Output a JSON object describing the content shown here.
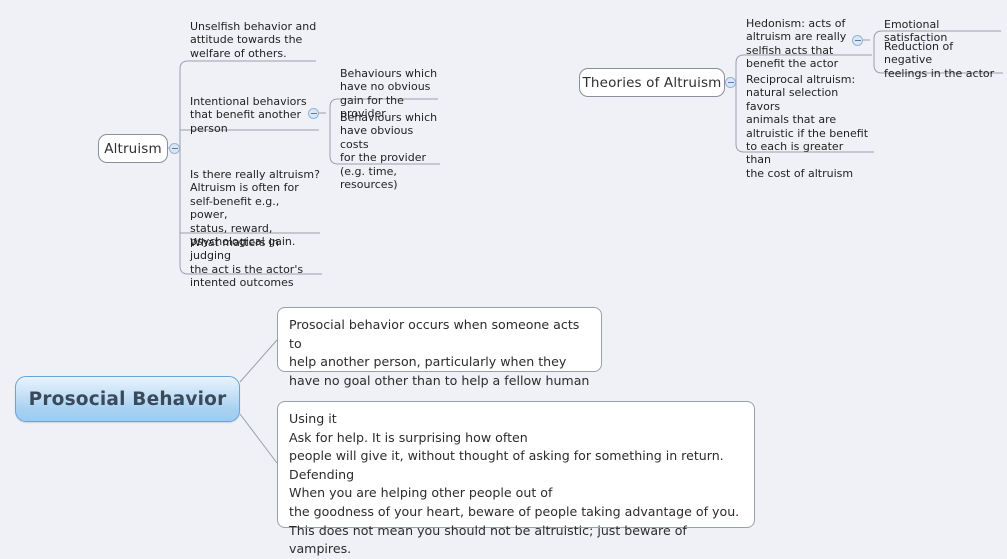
{
  "app": {
    "type": "mind-map",
    "canvas_background": "#f0f1f6",
    "accent_color": "#9ecbef",
    "node_border_color": "#8a8f98",
    "connector_color": "#9aa0a8"
  },
  "map": {
    "root_nodes": [
      {
        "id": "altruism",
        "label": "Altruism"
      },
      {
        "id": "theories",
        "label": "Theories of Altruism"
      },
      {
        "id": "prosocial",
        "label": "Prosocial Behavior"
      }
    ]
  },
  "altruism_branch": {
    "title": "Altruism",
    "children": [
      {
        "text": "Unselfish behavior and\n attitude towards the\nwelfare of others."
      },
      {
        "text": "Intentional behaviors\n that benefit another\nperson",
        "children": [
          {
            "text": "Behaviours which\nhave no obvious\ngain for the provider"
          },
          {
            "text": "Behaviours which\nhave obvious costs\nfor the provider\n(e.g. time, resources)"
          }
        ]
      },
      {
        "text": "Is there really altruism?\nAltruism is often for\nself-benefit e.g., power,\n status, reward,\npsychological gain."
      },
      {
        "text": "What matters in judging\nthe act is the actor's\nintented outcomes"
      }
    ]
  },
  "theories_branch": {
    "title": "Theories of Altruism",
    "children": [
      {
        "text": "Hedonism: acts of\naltruism are really\nselfish acts that\nbenefit the actor",
        "children": [
          {
            "text": "Emotional satisfaction"
          },
          {
            "text": "Reduction of negative\nfeelings in the actor"
          }
        ]
      },
      {
        "text": "Reciprocal altruism:\nnatural selection favors\nanimals that are\naltruistic if the benefit\n to each is greater than\n the cost of altruism"
      }
    ]
  },
  "prosocial_branch": {
    "title": "Prosocial Behavior",
    "notes": [
      {
        "text": "Prosocial behavior occurs when someone acts to\nhelp another person, particularly when they\nhave no goal other than to help a fellow human"
      },
      {
        "text": "Using it\nAsk for help. It is surprising how often\npeople will give it, without thought of asking for something in return.\nDefending\nWhen you are helping other people out of\nthe goodness of your heart, beware of people taking advantage of you.\nThis does not mean you should not be altruistic; just beware of vampires."
      }
    ]
  },
  "icons": {
    "collapse": "minus-circle-icon"
  }
}
